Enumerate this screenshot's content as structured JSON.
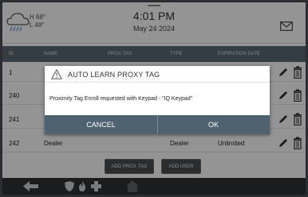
{
  "header": {
    "weather": {
      "icon": "rain-cloud-icon",
      "high": "H 68°",
      "low": "L 48°"
    },
    "time": "4:01 PM",
    "date": "May 24 2024",
    "mail_icon": "envelope-icon"
  },
  "table": {
    "columns": [
      "ID",
      "NAME",
      "PROX TAG",
      "TYPE",
      "EXPIRATION DATE"
    ],
    "rows": [
      {
        "id": "1",
        "name": "",
        "type": "",
        "expiration": ""
      },
      {
        "id": "240",
        "name": "",
        "type": "",
        "expiration": ""
      },
      {
        "id": "241",
        "name": "",
        "type": "",
        "expiration": ""
      },
      {
        "id": "242",
        "name": "Dealer",
        "type": "Dealer",
        "expiration": "Unlimited"
      }
    ]
  },
  "buttons": {
    "add_prox_tag": "ADD PROX TAG",
    "add_user": "ADD USER"
  },
  "dialog": {
    "title": "AUTO LEARN PROXY TAG",
    "message": "Proximity Tag Enroll requested with Keypad - \"IQ Keypad\"",
    "cancel": "CANCEL",
    "ok": "OK"
  },
  "colors": {
    "table_header": "#5a6a72",
    "dialog_button_bar": "#4e6270",
    "nav_bar": "#2e3135"
  }
}
